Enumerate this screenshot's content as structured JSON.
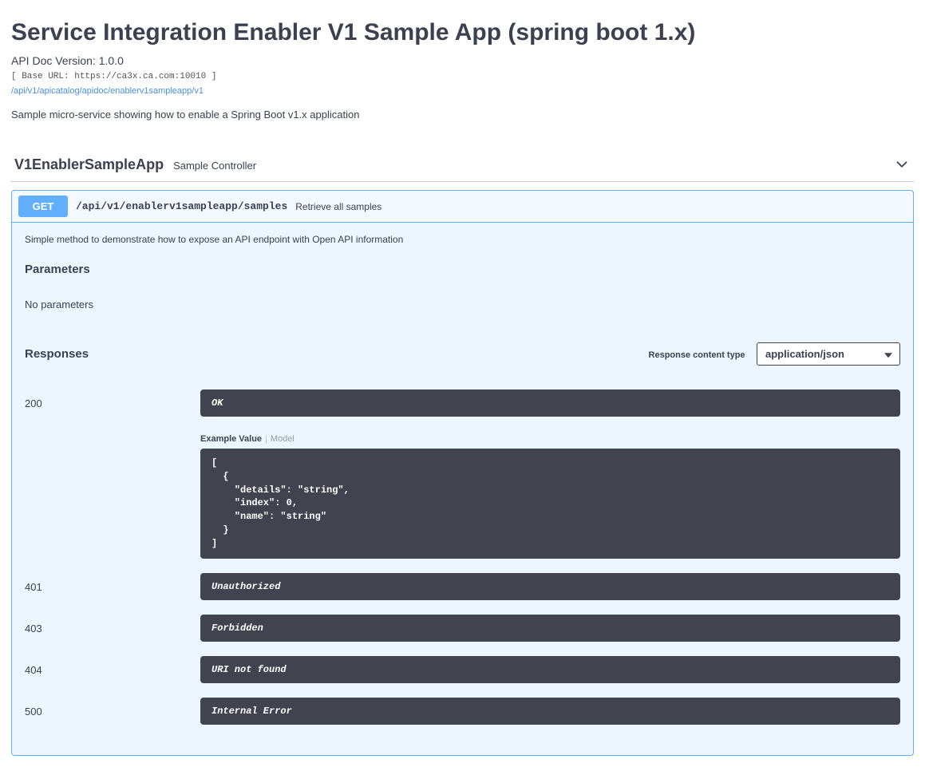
{
  "header": {
    "title": "Service Integration Enabler V1 Sample App (spring boot 1.x)",
    "version_label": "API Doc Version: 1.0.0",
    "base_url_line": "[ Base URL: https://ca3x.ca.com:10010 ]",
    "api_link": "/api/v1/apicatalog/apidoc/enablerv1sampleapp/v1",
    "description": "Sample micro-service showing how to enable a Spring Boot v1.x application"
  },
  "tag": {
    "name": "V1EnablerSampleApp",
    "desc": "Sample Controller"
  },
  "operation": {
    "method": "GET",
    "path": "/api/v1/enablerv1sampleapp/samples",
    "summary": "Retrieve all samples",
    "description": "Simple method to demonstrate how to expose an API endpoint with Open API information",
    "parameters_title": "Parameters",
    "no_params": "No parameters",
    "responses_title": "Responses",
    "content_type_label": "Response content type",
    "content_type_value": "application/json",
    "tabs": {
      "example": "Example Value",
      "model": "Model"
    },
    "example_body": "[\n  {\n    \"details\": \"string\",\n    \"index\": 0,\n    \"name\": \"string\"\n  }\n]",
    "responses": [
      {
        "code": "200",
        "msg": "OK",
        "has_example": true
      },
      {
        "code": "401",
        "msg": "Unauthorized",
        "has_example": false
      },
      {
        "code": "403",
        "msg": "Forbidden",
        "has_example": false
      },
      {
        "code": "404",
        "msg": "URI not found",
        "has_example": false
      },
      {
        "code": "500",
        "msg": "Internal Error",
        "has_example": false
      }
    ]
  }
}
